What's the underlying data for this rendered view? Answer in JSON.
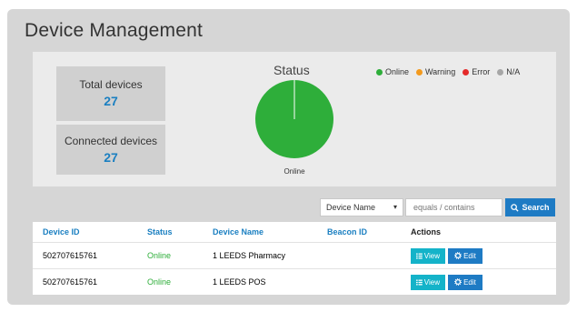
{
  "page": {
    "title": "Device Management"
  },
  "summary": {
    "total_label": "Total devices",
    "total_value": "27",
    "connected_label": "Connected devices",
    "connected_value": "27"
  },
  "status_chart": {
    "title": "Status",
    "caption": "Online",
    "legend": [
      {
        "label": "Online",
        "color": "#2eae3a"
      },
      {
        "label": "Warning",
        "color": "#f39a1e"
      },
      {
        "label": "Error",
        "color": "#e42a2a"
      },
      {
        "label": "N/A",
        "color": "#a6a6a6"
      }
    ],
    "slices": [
      {
        "label": "Online",
        "value": 27,
        "color": "#2eae3a"
      }
    ]
  },
  "filter": {
    "field": "Device Name",
    "caret": "▾",
    "placeholder": "equals / contains",
    "search_label": "Search",
    "search_icon": "magnifier-icon"
  },
  "table": {
    "headers": [
      "Device ID",
      "Status",
      "Device Name",
      "Beacon ID",
      "Actions"
    ],
    "rows": [
      {
        "device_id": "502707615761",
        "status": "Online",
        "device_name": "1 LEEDS Pharmacy",
        "beacon_id": ""
      },
      {
        "device_id": "502707615761",
        "status": "Online",
        "device_name": "1 LEEDS POS",
        "beacon_id": ""
      }
    ],
    "view_label": "View",
    "edit_label": "Edit",
    "view_icon": "list-icon",
    "edit_icon": "gear-icon"
  }
}
